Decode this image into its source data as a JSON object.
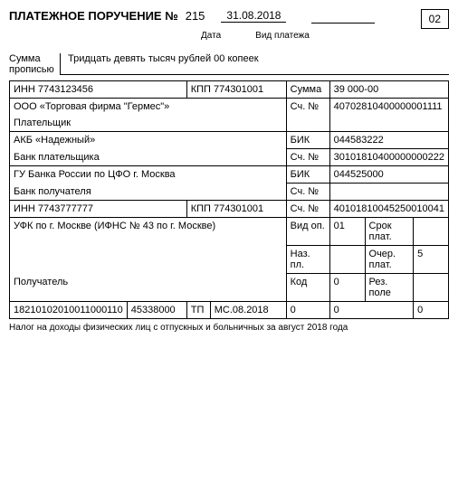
{
  "header": {
    "title": "ПЛАТЕЖНОЕ ПОРУЧЕНИЕ №",
    "number": "215",
    "date": "31.08.2018",
    "date_label": "Дата",
    "type_label": "Вид платежа",
    "code": "02"
  },
  "sum_words": {
    "label1": "Сумма",
    "label2": "прописью",
    "text": "Тридцать девять тысяч рублей 00 копеек"
  },
  "payer": {
    "inn_label": "ИНН",
    "inn": "7743123456",
    "kpp_label": "КПП",
    "kpp": "774301001",
    "sum_label": "Сумма",
    "sum": "39 000-00",
    "name": "ООО «Торговая фирма \"Гермес\"»",
    "acc_label": "Сч. №",
    "acc": "40702810400000001111",
    "label": "Плательщик"
  },
  "payer_bank": {
    "name": "АКБ «Надежный»",
    "bik_label": "БИК",
    "bik": "044583222",
    "acc_label": "Сч. №",
    "acc": "30101810400000000222",
    "label": "Банк плательщика"
  },
  "recip_bank": {
    "name": "ГУ Банка России по ЦФО г. Москва",
    "bik_label": "БИК",
    "bik": "044525000",
    "acc_label": "Сч. №",
    "acc": "",
    "label": "Банк получателя"
  },
  "recipient": {
    "inn_label": "ИНН",
    "inn": "7743777777",
    "kpp_label": "КПП",
    "kpp": "774301001",
    "acc_label": "Сч. №",
    "acc": "40101810045250010041",
    "name": "УФК по г. Москве (ИФНС № 43 по г. Москве)",
    "vid_op_label": "Вид оп.",
    "vid_op": "01",
    "srok_label": "Срок плат.",
    "naz_pl_label": "Наз. пл.",
    "ocher_label": "Очер. плат.",
    "ocher": "5",
    "kod_label": "Код",
    "kod": "0",
    "rez_label": "Рез. поле",
    "label": "Получатель"
  },
  "bottom": {
    "c1": "18210102010011000110",
    "c2": "45338000",
    "c3": "ТП",
    "c4": "МС.08.2018",
    "c5": "0",
    "c6": "0",
    "c7": "0"
  },
  "purpose": "Налог на доходы физических лиц с отпускных и больничных за август 2018 года"
}
